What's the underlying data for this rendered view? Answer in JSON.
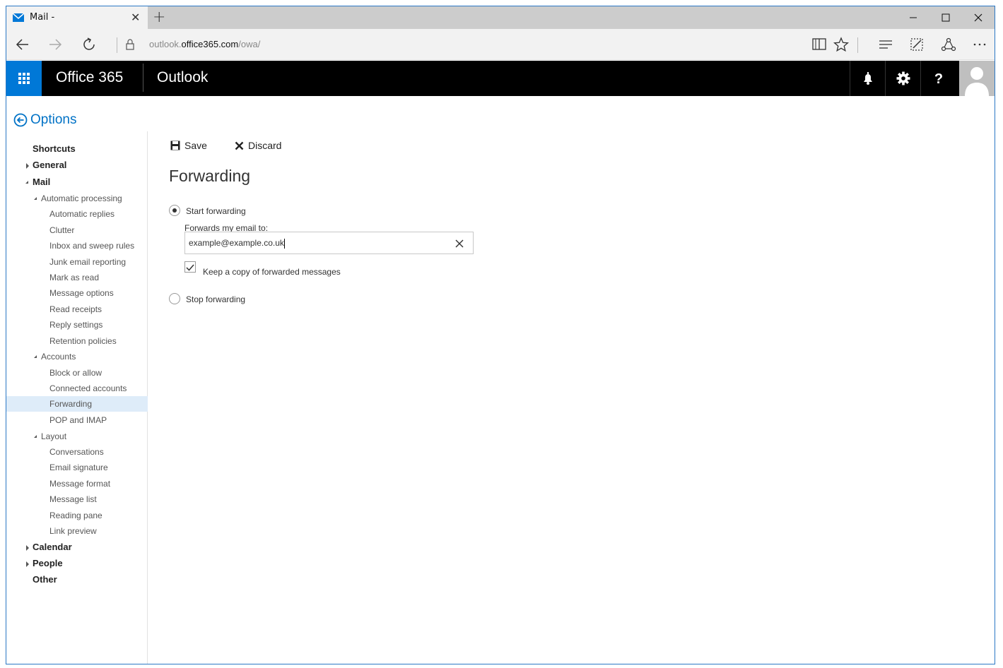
{
  "browser": {
    "tab_title": "Mail -",
    "new_tab": "+",
    "url_prefix": "outlook.",
    "url_domain": "office365.com",
    "url_path": "/owa/"
  },
  "header": {
    "suite": "Office 365",
    "app": "Outlook"
  },
  "options": {
    "back_label": "Options"
  },
  "nav": {
    "items": [
      {
        "label": "Shortcuts",
        "level": 0
      },
      {
        "label": "General",
        "level": 0
      },
      {
        "label": "Mail",
        "level": 0
      },
      {
        "label": "Automatic processing",
        "level": 1
      },
      {
        "label": "Automatic replies",
        "level": 2
      },
      {
        "label": "Clutter",
        "level": 2
      },
      {
        "label": "Inbox and sweep rules",
        "level": 2
      },
      {
        "label": "Junk email reporting",
        "level": 2
      },
      {
        "label": "Mark as read",
        "level": 2
      },
      {
        "label": "Message options",
        "level": 2
      },
      {
        "label": "Read receipts",
        "level": 2
      },
      {
        "label": "Reply settings",
        "level": 2
      },
      {
        "label": "Retention policies",
        "level": 2
      },
      {
        "label": "Accounts",
        "level": 1
      },
      {
        "label": "Block or allow",
        "level": 2
      },
      {
        "label": "Connected accounts",
        "level": 2
      },
      {
        "label": "Forwarding",
        "level": 2,
        "selected": true
      },
      {
        "label": "POP and IMAP",
        "level": 2
      },
      {
        "label": "Layout",
        "level": 1
      },
      {
        "label": "Conversations",
        "level": 2
      },
      {
        "label": "Email signature",
        "level": 2
      },
      {
        "label": "Message format",
        "level": 2
      },
      {
        "label": "Message list",
        "level": 2
      },
      {
        "label": "Reading pane",
        "level": 2
      },
      {
        "label": "Link preview",
        "level": 2
      },
      {
        "label": "Calendar",
        "level": 0
      },
      {
        "label": "People",
        "level": 0
      },
      {
        "label": "Other",
        "level": 0
      }
    ]
  },
  "main": {
    "save_label": "Save",
    "discard_label": "Discard",
    "title": "Forwarding",
    "start_forwarding": "Start forwarding",
    "forwards_to_label": "Forwards my email to:",
    "forward_address": "example@example.co.uk",
    "keep_copy": "Keep a copy of forwarded messages",
    "keep_copy_checked": true,
    "stop_forwarding": "Stop forwarding",
    "forwarding_enabled": true
  },
  "colors": {
    "accent": "#0078d7",
    "link": "#0072c6",
    "selected_bg": "#deecf9"
  }
}
